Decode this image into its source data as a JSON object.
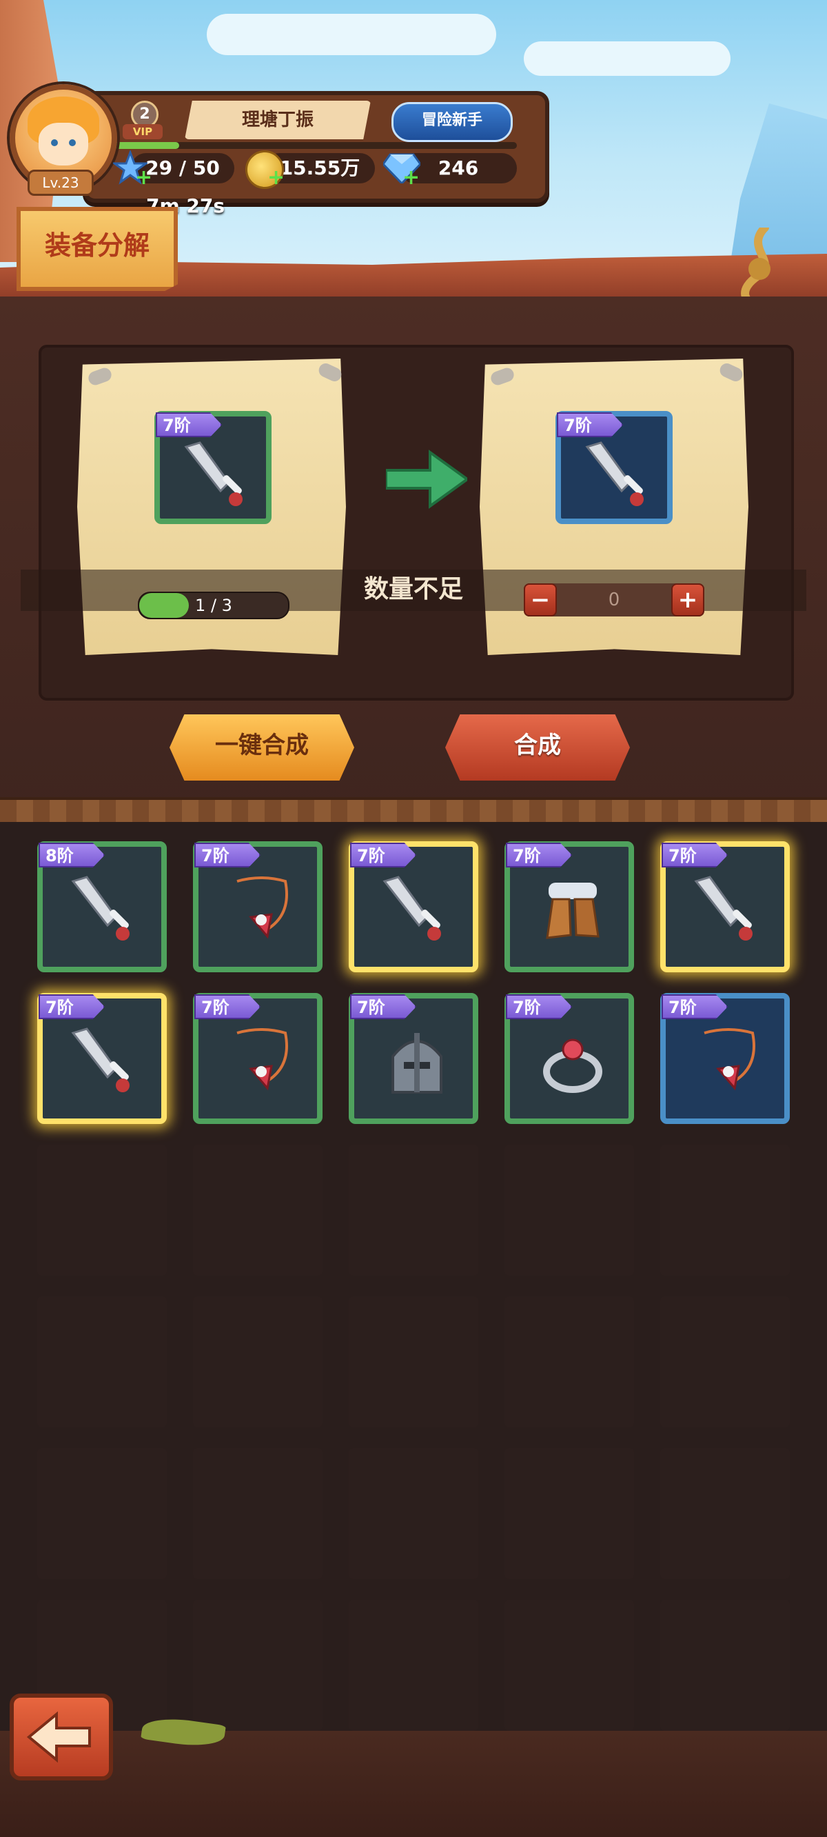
{
  "player": {
    "level_label": "Lv.23",
    "vip_level": "2",
    "vip_text": "VIP",
    "name": "理塘丁振",
    "title": "冒险新手",
    "stamina": "29 / 50",
    "gold": "15.55万",
    "gems": "246",
    "stamina_timer": "7m 27s",
    "xp_fraction": 0.17
  },
  "page": {
    "title": "装备分解"
  },
  "synthesis": {
    "source_tier": "7阶",
    "target_tier": "7阶",
    "progress_label": "1 / 3",
    "progress_fraction": 0.3333,
    "status_text": "数量不足",
    "quantity": "0",
    "minus_symbol": "−",
    "plus_symbol": "+"
  },
  "buttons": {
    "one_click": "一键合成",
    "synthesize": "合成"
  },
  "inventory": {
    "items": [
      {
        "tier": "8阶",
        "item": "sword",
        "frame": "green",
        "selected": false
      },
      {
        "tier": "7阶",
        "item": "amulet",
        "frame": "green",
        "selected": false
      },
      {
        "tier": "7阶",
        "item": "sword",
        "frame": "green",
        "selected": true
      },
      {
        "tier": "7阶",
        "item": "boots",
        "frame": "green",
        "selected": false
      },
      {
        "tier": "7阶",
        "item": "sword",
        "frame": "green",
        "selected": true
      },
      {
        "tier": "7阶",
        "item": "sword",
        "frame": "green",
        "selected": true
      },
      {
        "tier": "7阶",
        "item": "amulet",
        "frame": "green",
        "selected": false
      },
      {
        "tier": "7阶",
        "item": "helmet",
        "frame": "green",
        "selected": false
      },
      {
        "tier": "7阶",
        "item": "ring",
        "frame": "green",
        "selected": false
      },
      {
        "tier": "7阶",
        "item": "amulet",
        "frame": "blue",
        "selected": false
      }
    ],
    "empty_slots": 20
  },
  "icons": {
    "stamina": "star-icon",
    "gold": "coin-icon",
    "gems": "diamond-icon",
    "back": "back-arrow-icon",
    "arrow": "right-arrow-icon"
  },
  "colors": {
    "frame_green": "#4fa15d",
    "frame_blue": "#4a8fc7",
    "selected_glow": "#ffe26a",
    "tier_badge": "#8a6ae0",
    "button_orange": "#f0a53a",
    "button_red": "#c8482e"
  }
}
